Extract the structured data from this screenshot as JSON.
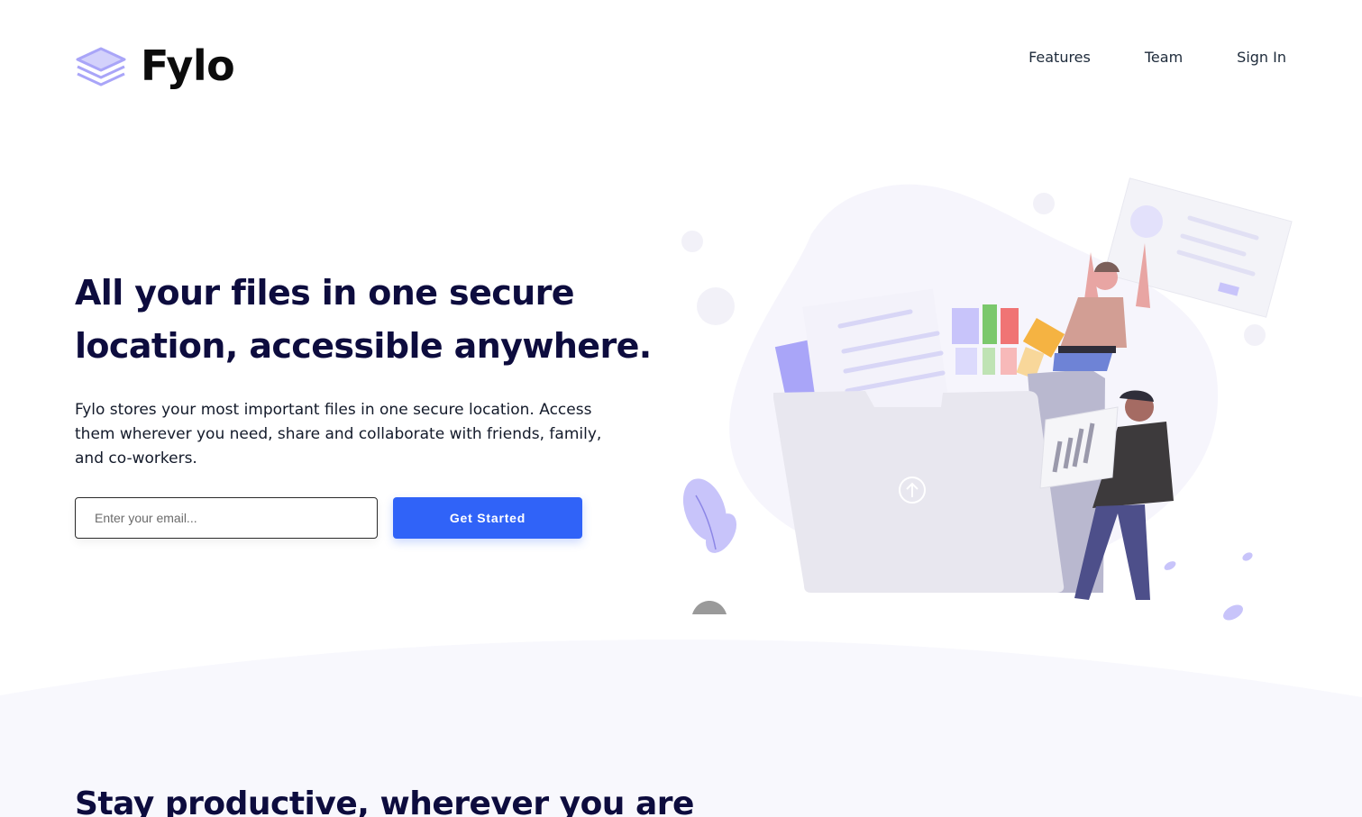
{
  "brand": {
    "name": "Fylo",
    "icon": "stacked-layers-icon",
    "accent": "#3063f8",
    "logo_color": "#a9a5f8"
  },
  "nav": {
    "items": [
      "Features",
      "Team",
      "Sign In"
    ]
  },
  "hero": {
    "title": "All your files in one secure location, accessible anywhere.",
    "description": "Fylo stores your most important files in one secure location. Access them wherever you need, share and collaborate with friends, family, and co-workers.",
    "email_placeholder": "Enter your email...",
    "cta_label": "Get Started",
    "illustration": "people-uploading-files-to-folder-illustration"
  },
  "section2": {
    "title": "Stay productive, wherever you are"
  }
}
